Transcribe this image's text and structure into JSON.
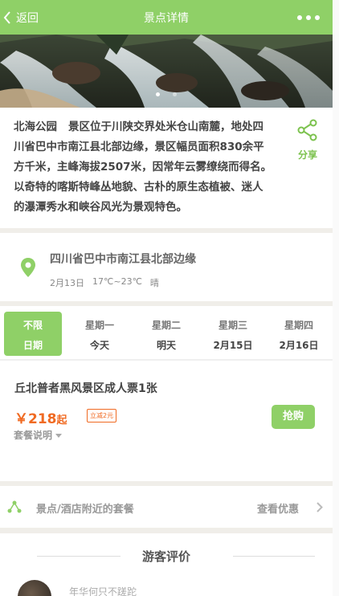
{
  "header": {
    "back_label": "返回",
    "title": "景点详情"
  },
  "intro": {
    "park_name": "北海公园",
    "description": "景区位于川陕交界处米仓山南麓，地处四川省巴中市南江县北部边缘，景区幅员面积830余平方千米，主峰海拔2507米，因常年云雾缭绕而得名。以奇特的喀斯特峰丛地貌、古朴的原生态植被、迷人的瀑潭秀水和峡谷风光为景观特色。",
    "share_label": "分享"
  },
  "location": {
    "address": "四川省巴中市南江县北部边缘",
    "date": "2月13日",
    "temperature": "17℃~23℃",
    "weather": "晴"
  },
  "days": [
    {
      "line1": "不限",
      "line2": "日期",
      "active": true
    },
    {
      "line1": "星期一",
      "line2": "今天",
      "active": false
    },
    {
      "line1": "星期二",
      "line2": "明天",
      "active": false
    },
    {
      "line1": "星期三",
      "line2": "2月15日",
      "active": false
    },
    {
      "line1": "星期四",
      "line2": "2月16日",
      "active": false
    }
  ],
  "ticket": {
    "name": "丘北普者黑风景区成人票1张",
    "price_main": "￥218",
    "price_suffix": "起",
    "discount_badge": "立减2元",
    "buy_label": "抢购",
    "package_desc": "套餐说明"
  },
  "nearby": {
    "label": "景点/酒店附近的套餐",
    "link": "查看优惠"
  },
  "reviews": {
    "title": "游客评价",
    "preview_text": "年华何只不蹉跎"
  },
  "colors": {
    "accent": "#8fd067",
    "price": "#f06a22",
    "divider": "#f0eee9"
  },
  "icons": {
    "back": "chevron-left-icon",
    "more": "more-dots-icon",
    "share": "share-icon",
    "location": "location-pin-icon",
    "nearby": "share-network-icon",
    "arrow": "chevron-right-icon"
  }
}
